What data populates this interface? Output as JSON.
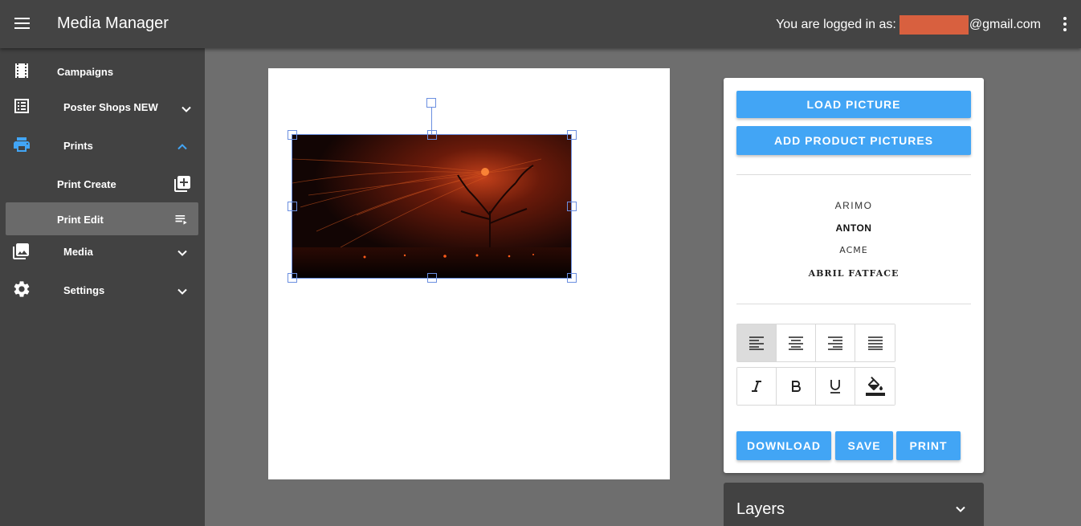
{
  "header": {
    "title": "Media Manager",
    "logged_in_prefix": "You are logged in as:",
    "email_suffix": "@gmail.com",
    "menu_icon": "hamburger-menu-icon",
    "more_icon": "more-vert-icon"
  },
  "sidebar": {
    "items": [
      {
        "label": "Campaigns",
        "icon": "film-icon"
      },
      {
        "label": "Poster Shops NEW",
        "icon": "list-icon"
      },
      {
        "label": "Prints",
        "icon": "printer-icon"
      },
      {
        "label": "Print Create",
        "icon": "add-box-icon"
      },
      {
        "label": "Print Edit",
        "icon": "playlist-play-icon"
      },
      {
        "label": "Media",
        "icon": "photo-library-icon"
      },
      {
        "label": "Settings",
        "icon": "gear-icon"
      }
    ],
    "active": "Print Edit",
    "accent_color": "#42a5f5"
  },
  "panel": {
    "load_picture": "LOAD PICTURE",
    "add_product_pictures": "ADD PRODUCT PICTURES",
    "fonts": [
      "ARIMO",
      "ANTON",
      "ACME",
      "ABRIL FATFACE"
    ],
    "align_tools": [
      "align-left-icon",
      "align-center-icon",
      "align-right-icon",
      "align-justify-icon"
    ],
    "style_tools": [
      "italic-icon",
      "bold-icon",
      "underline-icon",
      "fill-color-icon"
    ],
    "download": "DOWNLOAD",
    "save": "SAVE",
    "print": "PRINT"
  },
  "layers": {
    "title": "Layers"
  },
  "colors": {
    "topbar": "#444444",
    "sidebar": "#424242",
    "button": "#42a5f5",
    "redaction": "#d8603f",
    "selection": "#6b8fe0"
  }
}
